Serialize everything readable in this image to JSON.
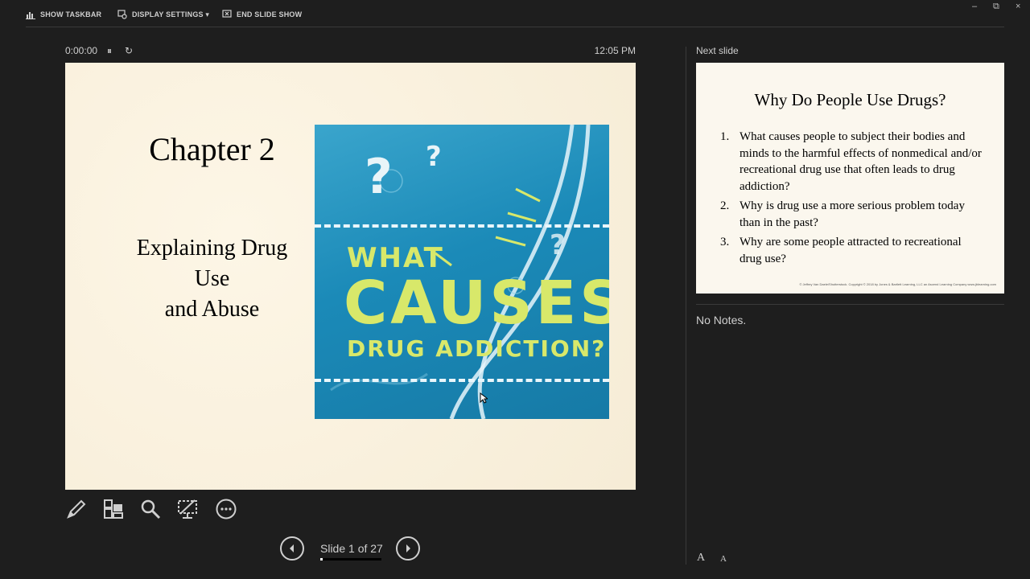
{
  "toolbar": {
    "show_taskbar": "SHOW TASKBAR",
    "display_settings": "DISPLAY SETTINGS ▾",
    "end_slide_show": "END SLIDE SHOW",
    "minimize": "–",
    "restore": "⧉",
    "close": "×"
  },
  "timer": {
    "elapsed": "0:00:00",
    "pause_icon": "⏸",
    "restart_icon": "↻",
    "clock": "12:05 PM"
  },
  "current_slide": {
    "title": "Chapter 2",
    "subtitle_lines": [
      "Explaining Drug",
      "Use",
      "and Abuse"
    ],
    "image_text": {
      "what": "WHAT",
      "causes": "CAUSES",
      "drug_addiction": "DRUG ADDICTION?"
    }
  },
  "navigation": {
    "prev_icon": "◀",
    "next_icon": "▶",
    "slide_counter": "Slide 1 of 27",
    "current": 1,
    "total": 27
  },
  "tools": [
    "pen-icon",
    "grid-icon",
    "magnifier-icon",
    "black-screen-icon",
    "more-icon"
  ],
  "next_slide_panel": {
    "label": "Next slide",
    "title": "Why Do People Use Drugs?",
    "items": [
      {
        "num": "1.",
        "text": "What causes people to subject their bodies and minds to the harmful effects of nonmedical and/or recreational drug use that often leads to drug addiction?"
      },
      {
        "num": "2.",
        "text": "Why is drug use a more serious problem today than in the past?"
      },
      {
        "num": "3.",
        "text": "Why are some people attracted to recreational drug use?"
      }
    ],
    "copyright": "© Jeffrey Van Daele/Shutterstock. Copyright © 2018 by Jones & Bartlett Learning, LLC an Ascend Learning Company www.jblearning.com"
  },
  "notes": {
    "text": "No Notes.",
    "increase_font": "A",
    "decrease_font": "A"
  },
  "colors": {
    "background": "#1e1e1e",
    "slide_bg": "#fbf3e1",
    "image_blue": "#1b8ab8",
    "image_text": "#d8e86a"
  }
}
